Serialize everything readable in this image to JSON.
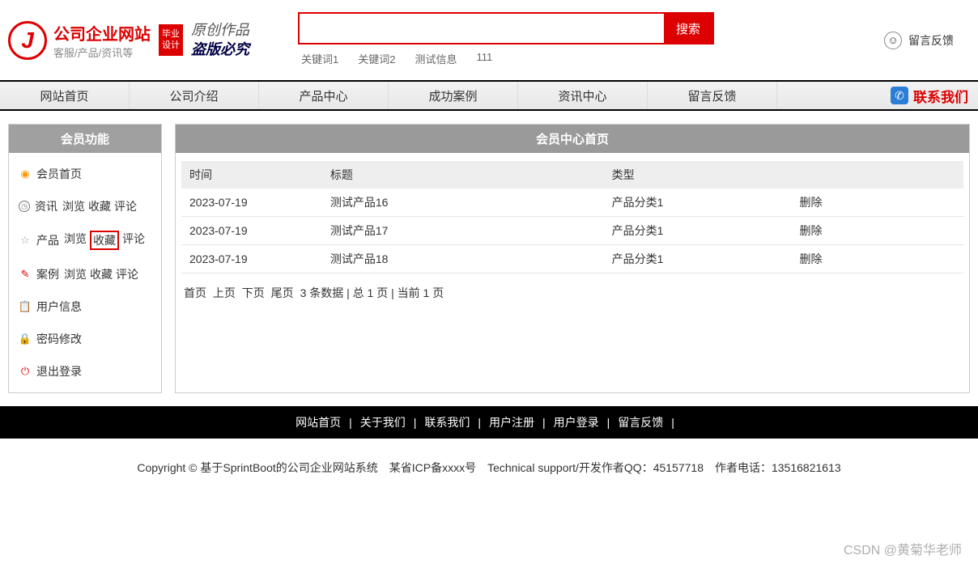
{
  "header": {
    "logo_title": "公司企业网站",
    "logo_sub": "客服/产品/资讯等",
    "badge_l1": "毕业",
    "badge_l2": "设计",
    "slogan_l1": "原创作品",
    "slogan_l2": "盗版必究",
    "search_placeholder": "",
    "search_btn": "搜索",
    "keywords": [
      "关键词1",
      "关键词2",
      "测试信息",
      "111"
    ],
    "feedback_label": "留言反馈"
  },
  "nav": {
    "items": [
      "网站首页",
      "公司介绍",
      "产品中心",
      "成功案例",
      "资讯中心",
      "留言反馈"
    ],
    "contact": "联系我们"
  },
  "sidebar": {
    "title": "会员功能",
    "home": "会员首页",
    "news_label": "资讯",
    "product_label": "产品",
    "case_label": "案例",
    "browse": "浏览",
    "favorite": "收藏",
    "comment": "评论",
    "user_info": "用户信息",
    "password": "密码修改",
    "logout": "退出登录"
  },
  "main": {
    "title": "会员中心首页",
    "columns": {
      "time": "时间",
      "title": "标题",
      "type": "类型",
      "action": ""
    },
    "rows": [
      {
        "time": "2023-07-19",
        "title": "测试产品16",
        "type": "产品分类1",
        "action": "删除"
      },
      {
        "time": "2023-07-19",
        "title": "测试产品17",
        "type": "产品分类1",
        "action": "删除"
      },
      {
        "time": "2023-07-19",
        "title": "测试产品18",
        "type": "产品分类1",
        "action": "删除"
      }
    ],
    "pagination": {
      "first": "首页",
      "prev": "上页",
      "next": "下页",
      "last": "尾页",
      "summary": "3 条数据 | 总 1 页 | 当前 1 页"
    }
  },
  "footer": {
    "links": [
      "网站首页",
      "关于我们",
      "联系我们",
      "用户注册",
      "用户登录",
      "留言反馈"
    ],
    "copyright": "Copyright © 基于SprintBoot的公司企业网站系统　某省ICP备xxxx号　Technical support/开发作者QQ：45157718　作者电话：13516821613"
  },
  "watermark": "CSDN @黄菊华老师"
}
